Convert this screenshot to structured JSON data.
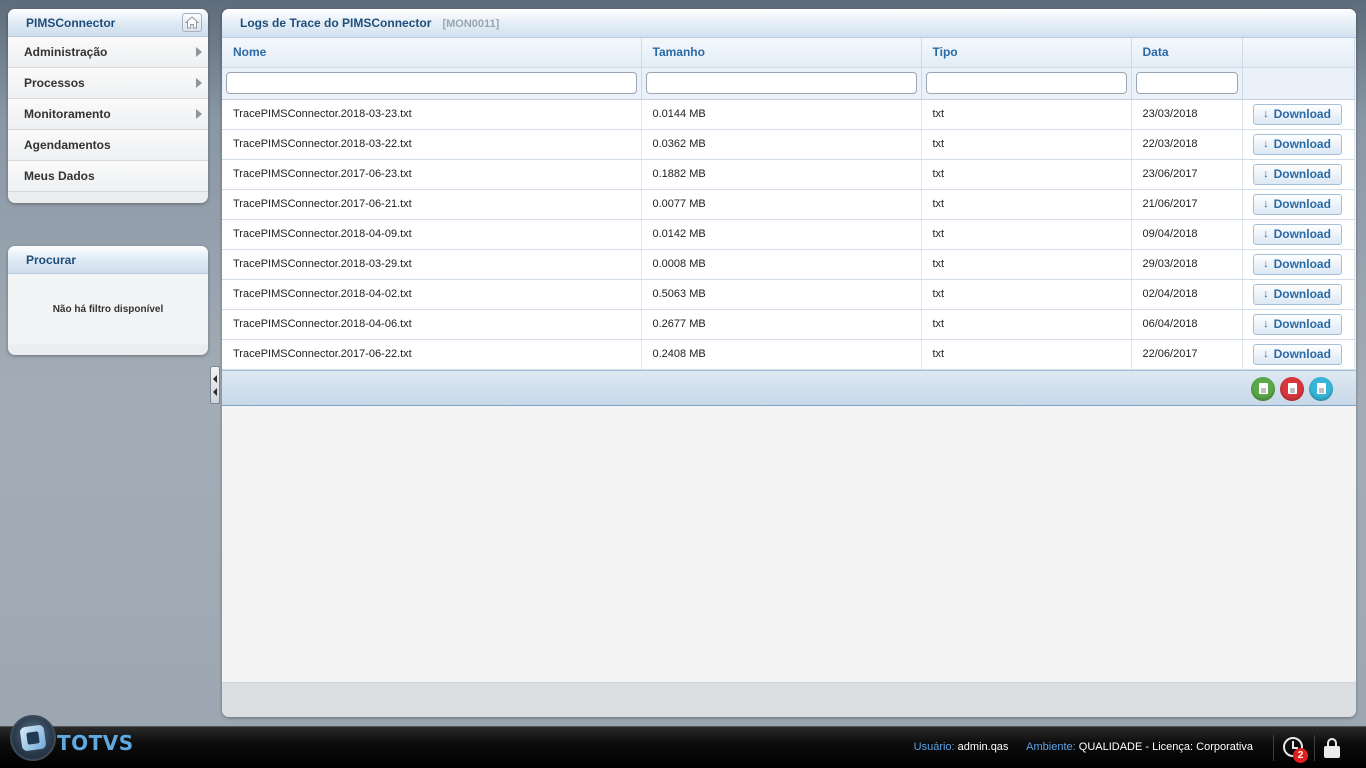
{
  "nav": {
    "title": "PIMSConnector",
    "items": [
      {
        "label": "Administração",
        "has_submenu": true
      },
      {
        "label": "Processos",
        "has_submenu": true
      },
      {
        "label": "Monitoramento",
        "has_submenu": true
      },
      {
        "label": "Agendamentos",
        "has_submenu": false
      },
      {
        "label": "Meus Dados",
        "has_submenu": false
      }
    ]
  },
  "search": {
    "title": "Procurar",
    "empty_text": "Não há filtro disponível"
  },
  "main": {
    "title": "Logs de Trace do PIMSConnector",
    "code": "[MON0011]",
    "columns": [
      "Nome",
      "Tamanho",
      "Tipo",
      "Data"
    ],
    "download_label": "Download",
    "rows": [
      {
        "nome": "TracePIMSConnector.2018-03-23.txt",
        "tamanho": "0.0144 MB",
        "tipo": "txt",
        "data": "23/03/2018"
      },
      {
        "nome": "TracePIMSConnector.2018-03-22.txt",
        "tamanho": "0.0362 MB",
        "tipo": "txt",
        "data": "22/03/2018"
      },
      {
        "nome": "TracePIMSConnector.2017-06-23.txt",
        "tamanho": "0.1882 MB",
        "tipo": "txt",
        "data": "23/06/2017"
      },
      {
        "nome": "TracePIMSConnector.2017-06-21.txt",
        "tamanho": "0.0077 MB",
        "tipo": "txt",
        "data": "21/06/2017"
      },
      {
        "nome": "TracePIMSConnector.2018-04-09.txt",
        "tamanho": "0.0142 MB",
        "tipo": "txt",
        "data": "09/04/2018"
      },
      {
        "nome": "TracePIMSConnector.2018-03-29.txt",
        "tamanho": "0.0008 MB",
        "tipo": "txt",
        "data": "29/03/2018"
      },
      {
        "nome": "TracePIMSConnector.2018-04-02.txt",
        "tamanho": "0.5063 MB",
        "tipo": "txt",
        "data": "02/04/2018"
      },
      {
        "nome": "TracePIMSConnector.2018-04-06.txt",
        "tamanho": "0.2677 MB",
        "tipo": "txt",
        "data": "06/04/2018"
      },
      {
        "nome": "TracePIMSConnector.2017-06-22.txt",
        "tamanho": "0.2408 MB",
        "tipo": "txt",
        "data": "22/06/2017"
      }
    ],
    "export_buttons": [
      {
        "name": "export-excel-button",
        "color": "#5aa84a",
        "icon": "spreadsheet-icon"
      },
      {
        "name": "export-pdf-button",
        "color": "#d8373d",
        "icon": "pdf-icon"
      },
      {
        "name": "export-csv-button",
        "color": "#38b6d8",
        "icon": "document-icon"
      }
    ]
  },
  "footer": {
    "brand": "TOTVS",
    "user_label": "Usuário:",
    "user_value": "admin.qas",
    "env_label": "Ambiente:",
    "env_value": "QUALIDADE - Licença: Corporativa",
    "notification_count": "2"
  },
  "colors": {
    "accent": "#2a6aa6",
    "header_text": "#1f4e79",
    "status_key": "#5da3e6",
    "badge": "#e21f1f"
  }
}
